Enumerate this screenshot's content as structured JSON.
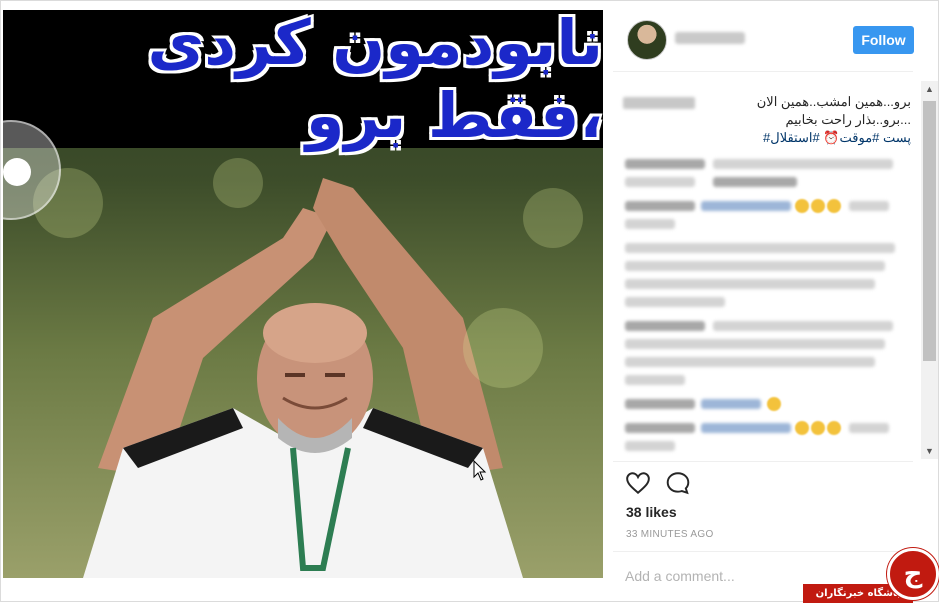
{
  "post": {
    "banner_text": "نابودمون کردی ،فقط برو"
  },
  "header": {
    "follow_label": "Follow"
  },
  "caption": {
    "line1": "برو...همین امشب..همین الان",
    "line2": "...برو..بذار راحت بخابیم",
    "hashtags": "پست #موقت⏰ #استقلال#"
  },
  "actions": {
    "likes": "38 likes",
    "timestamp": "33 MINUTES AGO"
  },
  "comment_box": {
    "placeholder": "Add a comment..."
  },
  "watermark": {
    "text": "باشگاه خبرنگاران",
    "logo_glyph": "ج"
  },
  "colors": {
    "follow_blue": "#3897f0",
    "hashtag_blue": "#003569",
    "banner_text": "#1b28c9",
    "watermark_red": "#c11a10"
  }
}
